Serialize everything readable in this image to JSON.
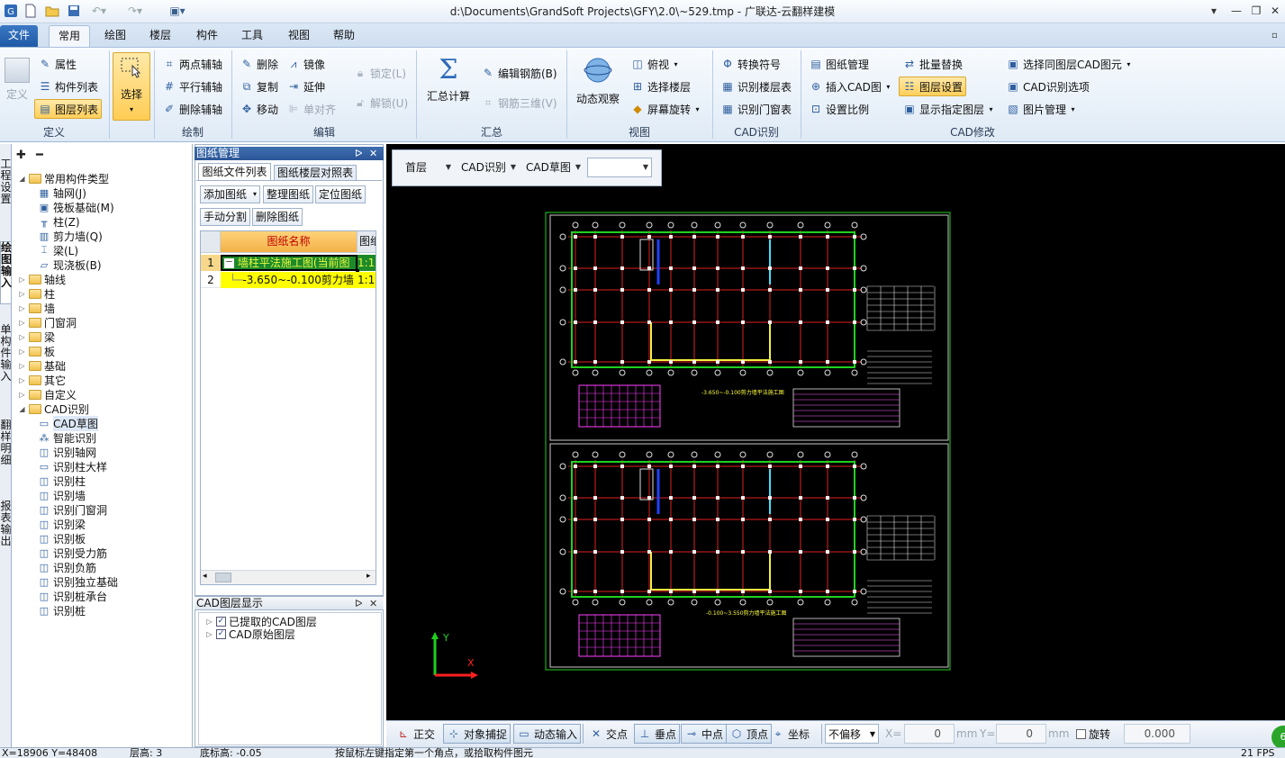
{
  "window": {
    "title": "d:\\Documents\\GrandSoft Projects\\GFY\\2.0\\~529.tmp - 广联达-云翻样建模",
    "controls": [
      "▾",
      "—",
      "❐",
      "✕"
    ]
  },
  "menu": {
    "tabs": [
      "文件",
      "常用",
      "绘图",
      "楼层",
      "构件",
      "工具",
      "视图",
      "帮助"
    ]
  },
  "ribbon": {
    "groups": {
      "define": "定义",
      "draw": "绘制",
      "edit": "编辑",
      "summary": "汇总",
      "view": "视图",
      "cad_recognize": "CAD识别",
      "cad_modify": "CAD修改"
    },
    "define": {
      "define": "定义",
      "property": "属性",
      "component_list": "构件列表",
      "layer_list": "图层列表"
    },
    "select": "选择",
    "draw": {
      "two_point_axis": "两点辅轴",
      "parallel_axis": "平行辅轴",
      "delete_axis": "删除辅轴"
    },
    "edit": {
      "delete": "删除",
      "copy": "复制",
      "move": "移动",
      "mirror": "镜像",
      "extend": "延伸",
      "single_align": "单对齐",
      "lock": "锁定(L)",
      "unlock": "解锁(U)"
    },
    "summary": {
      "calc": "汇总计算",
      "edit_rebar": "编辑钢筋(B)",
      "rebar_3d": "钢筋三维(V)"
    },
    "view": {
      "dynamic_view": "动态观察",
      "top_view": "俯视",
      "select_floor": "选择楼层",
      "screen_rotate": "屏幕旋转"
    },
    "cad_recognize": {
      "convert_symbol": "转换符号",
      "recognize_floor_table": "识别楼层表",
      "recognize_door_window_table": "识别门窗表"
    },
    "cad_modify": {
      "drawing_manage": "图纸管理",
      "insert_cad": "插入CAD图",
      "set_scale": "设置比例",
      "batch_replace": "批量替换",
      "layer_settings": "图层设置",
      "show_layer": "显示指定图层",
      "select_same_layer": "选择同图层CAD图元",
      "cad_options": "CAD识别选项",
      "image_manage": "图片管理"
    }
  },
  "left_tabs": [
    "工程设置",
    "绘图输入",
    "单构件输入",
    "翻样明细",
    "报表输出"
  ],
  "tree": {
    "toolbar": [
      "✚",
      "━"
    ],
    "items": [
      {
        "level": 0,
        "label": "常用构件类型",
        "expanded": true,
        "folder": true
      },
      {
        "level": 1,
        "label": "轴网(J)",
        "icon": "grid"
      },
      {
        "level": 1,
        "label": "筏板基础(M)",
        "icon": "raft"
      },
      {
        "level": 1,
        "label": "柱(Z)",
        "icon": "column"
      },
      {
        "level": 1,
        "label": "剪力墙(Q)",
        "icon": "wall"
      },
      {
        "level": 1,
        "label": "梁(L)",
        "icon": "beam"
      },
      {
        "level": 1,
        "label": "现浇板(B)",
        "icon": "slab"
      },
      {
        "level": 0,
        "label": "轴线",
        "expanded": false,
        "folder": true
      },
      {
        "level": 0,
        "label": "柱",
        "expanded": false,
        "folder": true
      },
      {
        "level": 0,
        "label": "墙",
        "expanded": false,
        "folder": true
      },
      {
        "level": 0,
        "label": "门窗洞",
        "expanded": false,
        "folder": true
      },
      {
        "level": 0,
        "label": "梁",
        "expanded": false,
        "folder": true
      },
      {
        "level": 0,
        "label": "板",
        "expanded": false,
        "folder": true
      },
      {
        "level": 0,
        "label": "基础",
        "expanded": false,
        "folder": true
      },
      {
        "level": 0,
        "label": "其它",
        "expanded": false,
        "folder": true
      },
      {
        "level": 0,
        "label": "自定义",
        "expanded": false,
        "folder": true
      },
      {
        "level": 0,
        "label": "CAD识别",
        "expanded": true,
        "folder": true
      },
      {
        "level": 1,
        "label": "CAD草图",
        "icon": "cad",
        "selected": true
      },
      {
        "level": 1,
        "label": "智能识别",
        "icon": "smart"
      },
      {
        "level": 1,
        "label": "识别轴网",
        "icon": "recog"
      },
      {
        "level": 1,
        "label": "识别柱大样",
        "icon": "cad"
      },
      {
        "level": 1,
        "label": "识别柱",
        "icon": "recog"
      },
      {
        "level": 1,
        "label": "识别墙",
        "icon": "recog"
      },
      {
        "level": 1,
        "label": "识别门窗洞",
        "icon": "recog"
      },
      {
        "level": 1,
        "label": "识别梁",
        "icon": "recog"
      },
      {
        "level": 1,
        "label": "识别板",
        "icon": "recog"
      },
      {
        "level": 1,
        "label": "识别受力筋",
        "icon": "recog"
      },
      {
        "level": 1,
        "label": "识别负筋",
        "icon": "recog"
      },
      {
        "level": 1,
        "label": "识别独立基础",
        "icon": "recog"
      },
      {
        "level": 1,
        "label": "识别桩承台",
        "icon": "recog"
      },
      {
        "level": 1,
        "label": "识别桩",
        "icon": "recog"
      }
    ]
  },
  "drawing_panel": {
    "title": "图纸管理",
    "pin": "ᐅ",
    "close": "✕",
    "tabs": [
      "图纸文件列表",
      "图纸楼层对照表"
    ],
    "buttons": [
      "添加图纸",
      "整理图纸",
      "定位图纸",
      "手动分割",
      "删除图纸"
    ],
    "columns": [
      "图纸名称",
      "图纸"
    ],
    "rows": [
      {
        "num": "1",
        "name": "墙柱平法施工图(当前图",
        "scale": "1:1",
        "toggle": "－"
      },
      {
        "num": "2",
        "name": "-3.650~-0.100剪力墙",
        "scale": "1:1"
      }
    ]
  },
  "layer_panel": {
    "title": "CAD图层显示",
    "items": [
      "已提取的CAD图层",
      "CAD原始图层"
    ]
  },
  "canvas_toolbar": {
    "floor": "首层",
    "category": "CAD识别",
    "component": "CAD草图",
    "empty": ""
  },
  "axes": {
    "y": "Y",
    "x": "X"
  },
  "drawing_text": {
    "title1": "-3.650~-0.100剪力墙平法施工图",
    "title2": "-0.100~3.550剪力墙平法施工图"
  },
  "bottom_toolbar": {
    "ortho": "正交",
    "snap": "对象捕捉",
    "dynamic_input": "动态输入",
    "intersection": "交点",
    "perpendicular": "垂点",
    "midpoint": "中点",
    "vertex": "顶点",
    "coordinate": "坐标",
    "offset": "不偏移",
    "x_label": "X=",
    "x_value": "0",
    "mm1": "mm",
    "y_label": "Y=",
    "y_value": "0",
    "mm2": "mm",
    "rotate": "旋转",
    "rotate_value": "0.000"
  },
  "status": {
    "coords": "X=18906 Y=48408",
    "floor_height": "层高: 3",
    "base_height": "底标高: -0.05",
    "hint": "按鼠标左键指定第一个角点，或拾取构件图元",
    "fps": "21 FPS"
  }
}
